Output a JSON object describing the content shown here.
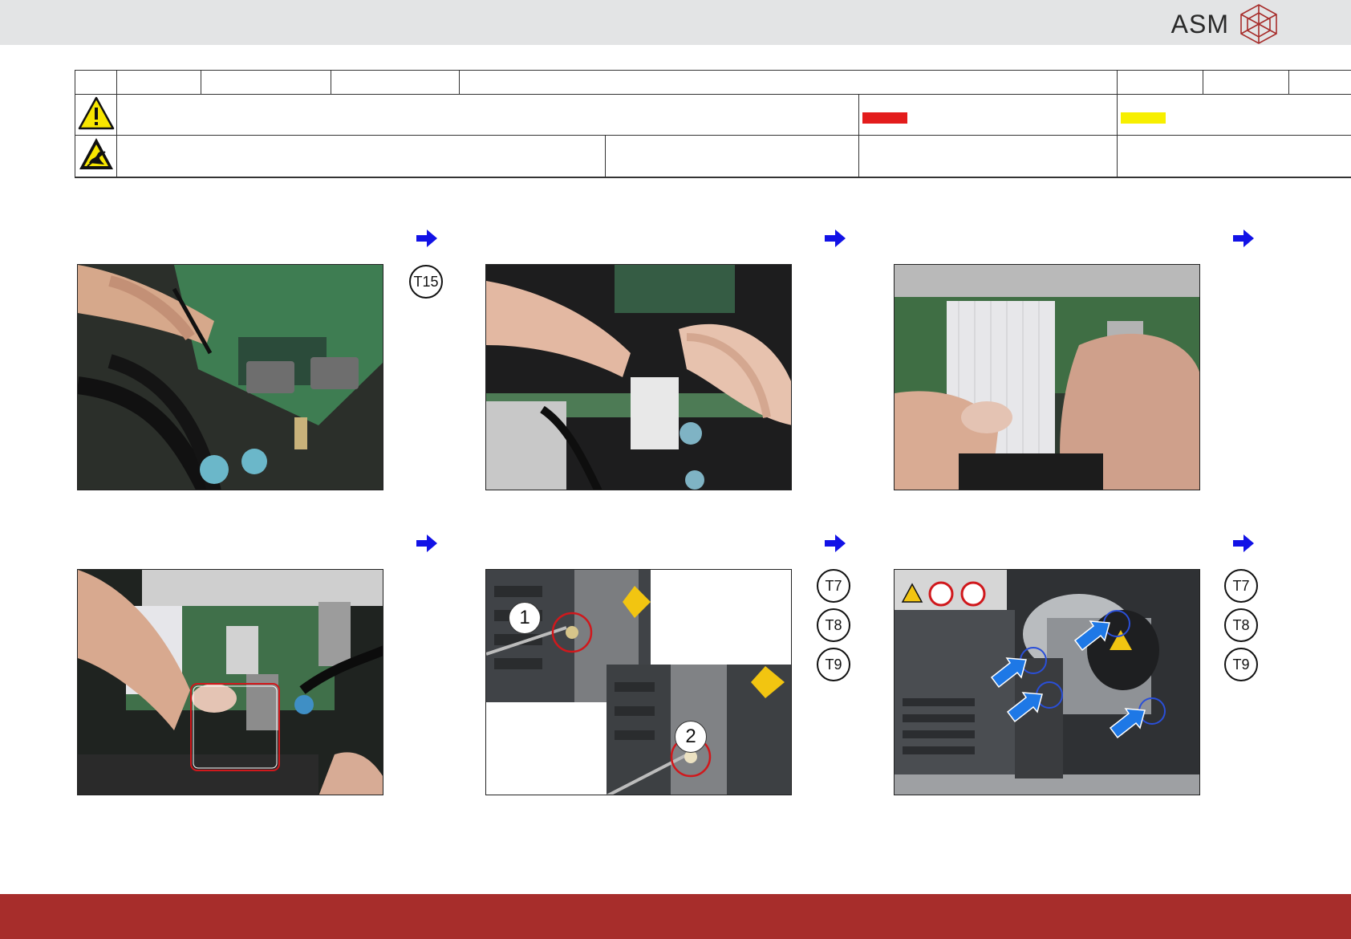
{
  "header": {
    "brand": "ASM"
  },
  "legend": {
    "danger_color": "#e31c1c",
    "warning_color": "#f7ef00"
  },
  "steps": [
    {
      "tools": [
        "T15"
      ]
    },
    {
      "tools": []
    },
    {
      "tools": []
    },
    {
      "tools": []
    },
    {
      "tools": [
        "T7",
        "T8",
        "T9"
      ],
      "markers": [
        "1",
        "2"
      ]
    },
    {
      "tools": [
        "T7",
        "T8",
        "T9"
      ]
    }
  ],
  "colors": {
    "header_bg": "#e3e4e5",
    "footer_bg": "#a72d2b",
    "arrow": "#1212e6",
    "highlight_circle": "#d0181c",
    "callout_arrow": "#1e78e6"
  }
}
